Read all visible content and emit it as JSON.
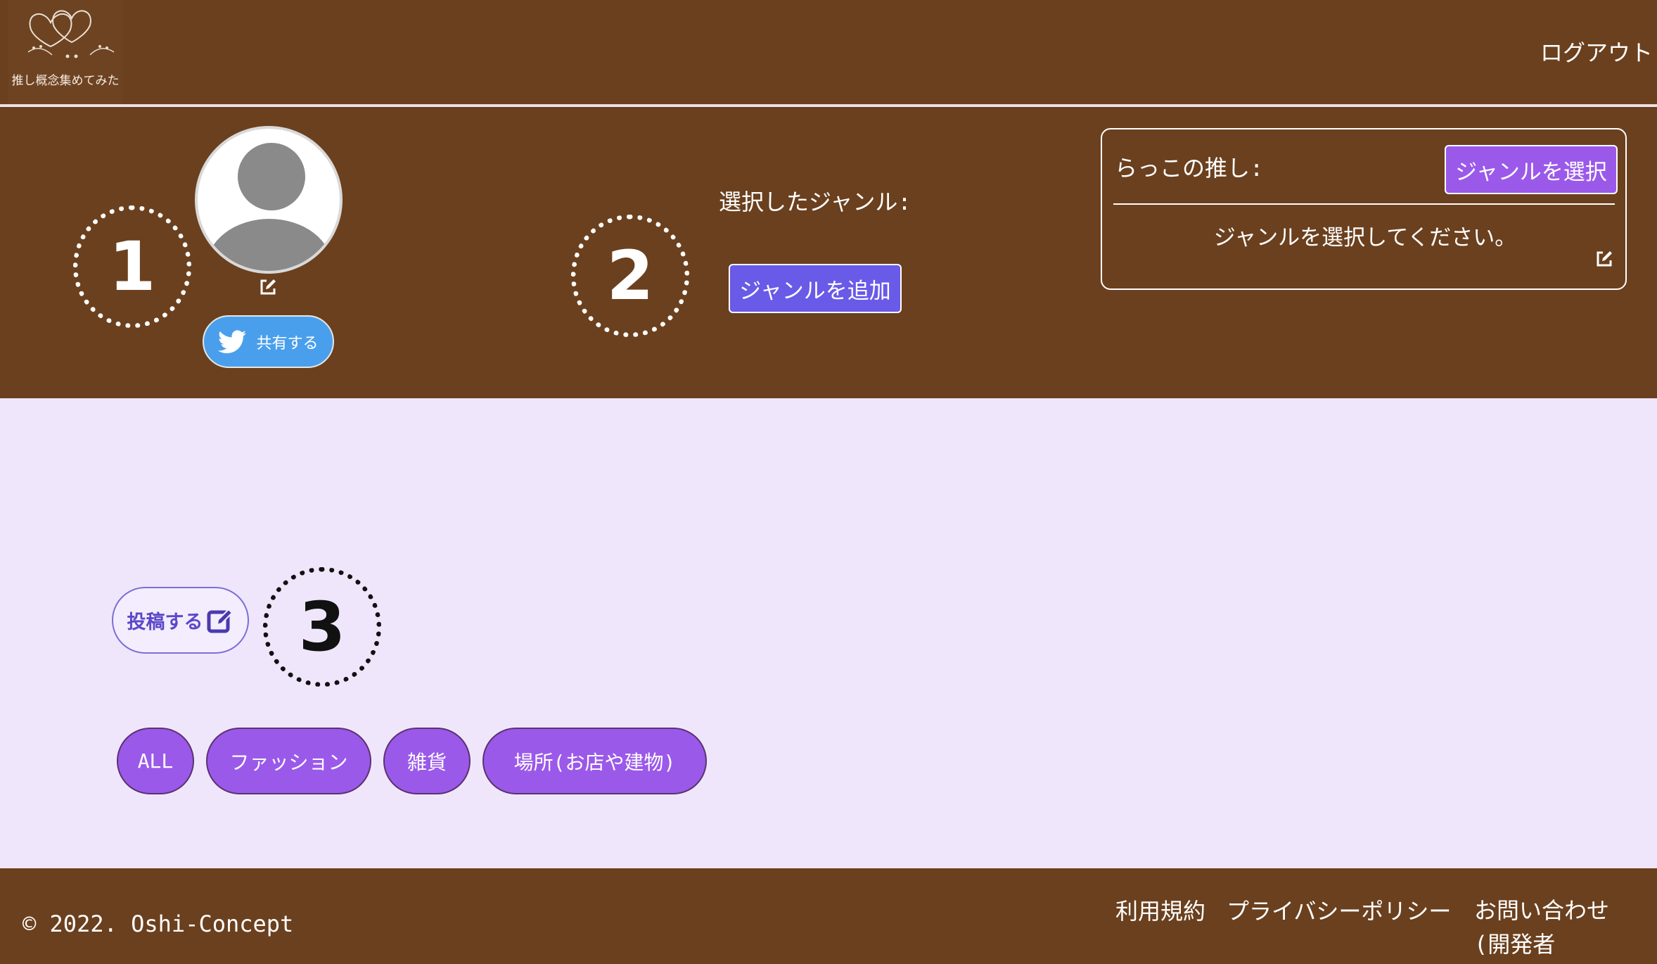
{
  "header": {
    "logo_text": "推し概念集めてみた",
    "logout_label": "ログアウト"
  },
  "profile": {
    "marker_1": "①",
    "share_label": "共有する"
  },
  "genre": {
    "marker_2": "②",
    "selected_label": "選択したジャンル:",
    "add_label": "ジャンルを追加"
  },
  "oshi": {
    "title": "らっこの推し:",
    "select_label": "ジャンルを選択",
    "message": "ジャンルを選択してください。"
  },
  "main": {
    "marker_3": "③",
    "post_label": "投稿する",
    "filters": [
      "ALL",
      "ファッション",
      "雑貨",
      "場所(お店や建物)"
    ]
  },
  "footer": {
    "copyright": "© 2022. Oshi-Concept",
    "terms": "利用規約",
    "privacy": "プライバシーポリシー",
    "contact_line1": "お問い合わせ",
    "contact_line2": "(開発者Twitter)"
  },
  "colors": {
    "brand_brown": "#6b401e",
    "page_background": "#f0e6fc",
    "accent_purple": "#9b59ea",
    "accent_indigo": "#6a5ae8",
    "twitter_blue": "#4a9fec"
  },
  "icons": [
    "hearts-logo-icon",
    "edit-icon",
    "twitter-bird-icon",
    "pen-square-icon"
  ]
}
